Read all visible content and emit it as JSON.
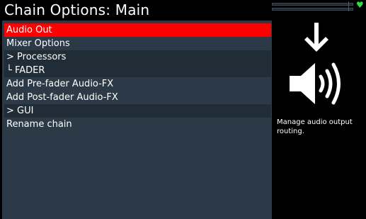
{
  "header": {
    "title": "Chain Options: Main"
  },
  "status": {
    "heart_icon": "heart-icon",
    "heart_color": "#2fe04a"
  },
  "menu": {
    "items": [
      {
        "label": "Audio Out",
        "state": "selected"
      },
      {
        "label": "Mixer Options",
        "state": "normal"
      },
      {
        "label": "> Processors",
        "state": "section"
      },
      {
        "label": "└ FADER",
        "state": "section"
      },
      {
        "label": "Add Pre-fader Audio-FX",
        "state": "normal"
      },
      {
        "label": "Add Post-fader Audio-FX",
        "state": "normal"
      },
      {
        "label": "> GUI",
        "state": "section"
      },
      {
        "label": "Rename chain",
        "state": "normal"
      }
    ]
  },
  "info": {
    "icon": "audio-output-icon",
    "description": "Manage audio output routing."
  },
  "colors": {
    "selected": "#ff0000",
    "panel": "#2b3a46",
    "section": "#202c36",
    "background": "#000000"
  }
}
